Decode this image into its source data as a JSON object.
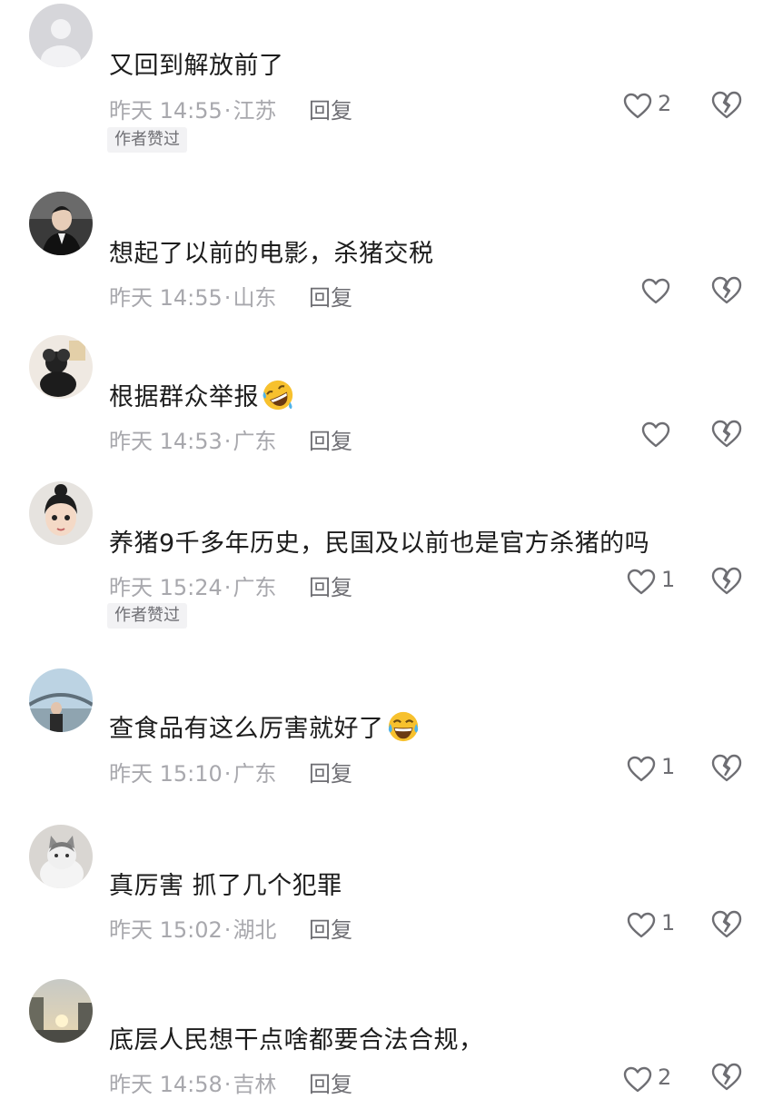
{
  "comments": [
    {
      "text": "又回到解放前了",
      "time": "昨天 14:55",
      "location": "江苏",
      "reply_label": "回复",
      "likes": "2",
      "author_liked": "作者赞过",
      "avatar": "default-avatar"
    },
    {
      "text": "想起了以前的电影，杀猪交税",
      "time": "昨天 14:55",
      "location": "山东",
      "reply_label": "回复",
      "likes": "",
      "avatar": "man-in-suit-avatar"
    },
    {
      "text": "根据群众举报",
      "emoji": "rofl-emoji",
      "time": "昨天 14:53",
      "location": "广东",
      "reply_label": "回复",
      "likes": "",
      "avatar": "black-toy-avatar"
    },
    {
      "text": "养猪9千多年历史，民国及以前也是官方杀猪的吗",
      "time": "昨天 15:24",
      "location": "广东",
      "reply_label": "回复",
      "likes": "1",
      "author_liked": "作者赞过",
      "avatar": "child-avatar"
    },
    {
      "text": "查食品有这么厉害就好了",
      "emoji": "joy-emoji",
      "time": "昨天 15:10",
      "location": "广东",
      "reply_label": "回复",
      "likes": "1",
      "avatar": "bridge-person-avatar"
    },
    {
      "text": "真厉害  抓了几个犯罪",
      "time": "昨天 15:02",
      "location": "湖北",
      "reply_label": "回复",
      "likes": "1",
      "avatar": "cat-avatar"
    },
    {
      "text": "底层人民想干点啥都要合法合规，",
      "time": "昨天 14:58",
      "location": "吉林",
      "reply_label": "回复",
      "likes": "2",
      "avatar": "sunset-street-avatar"
    }
  ],
  "colors": {
    "text": "#1c1c1c",
    "meta": "#a8a8ad",
    "action": "#6e6e73",
    "badge_bg": "#f2f2f4",
    "emoji_yellow": "#f7c12e"
  }
}
